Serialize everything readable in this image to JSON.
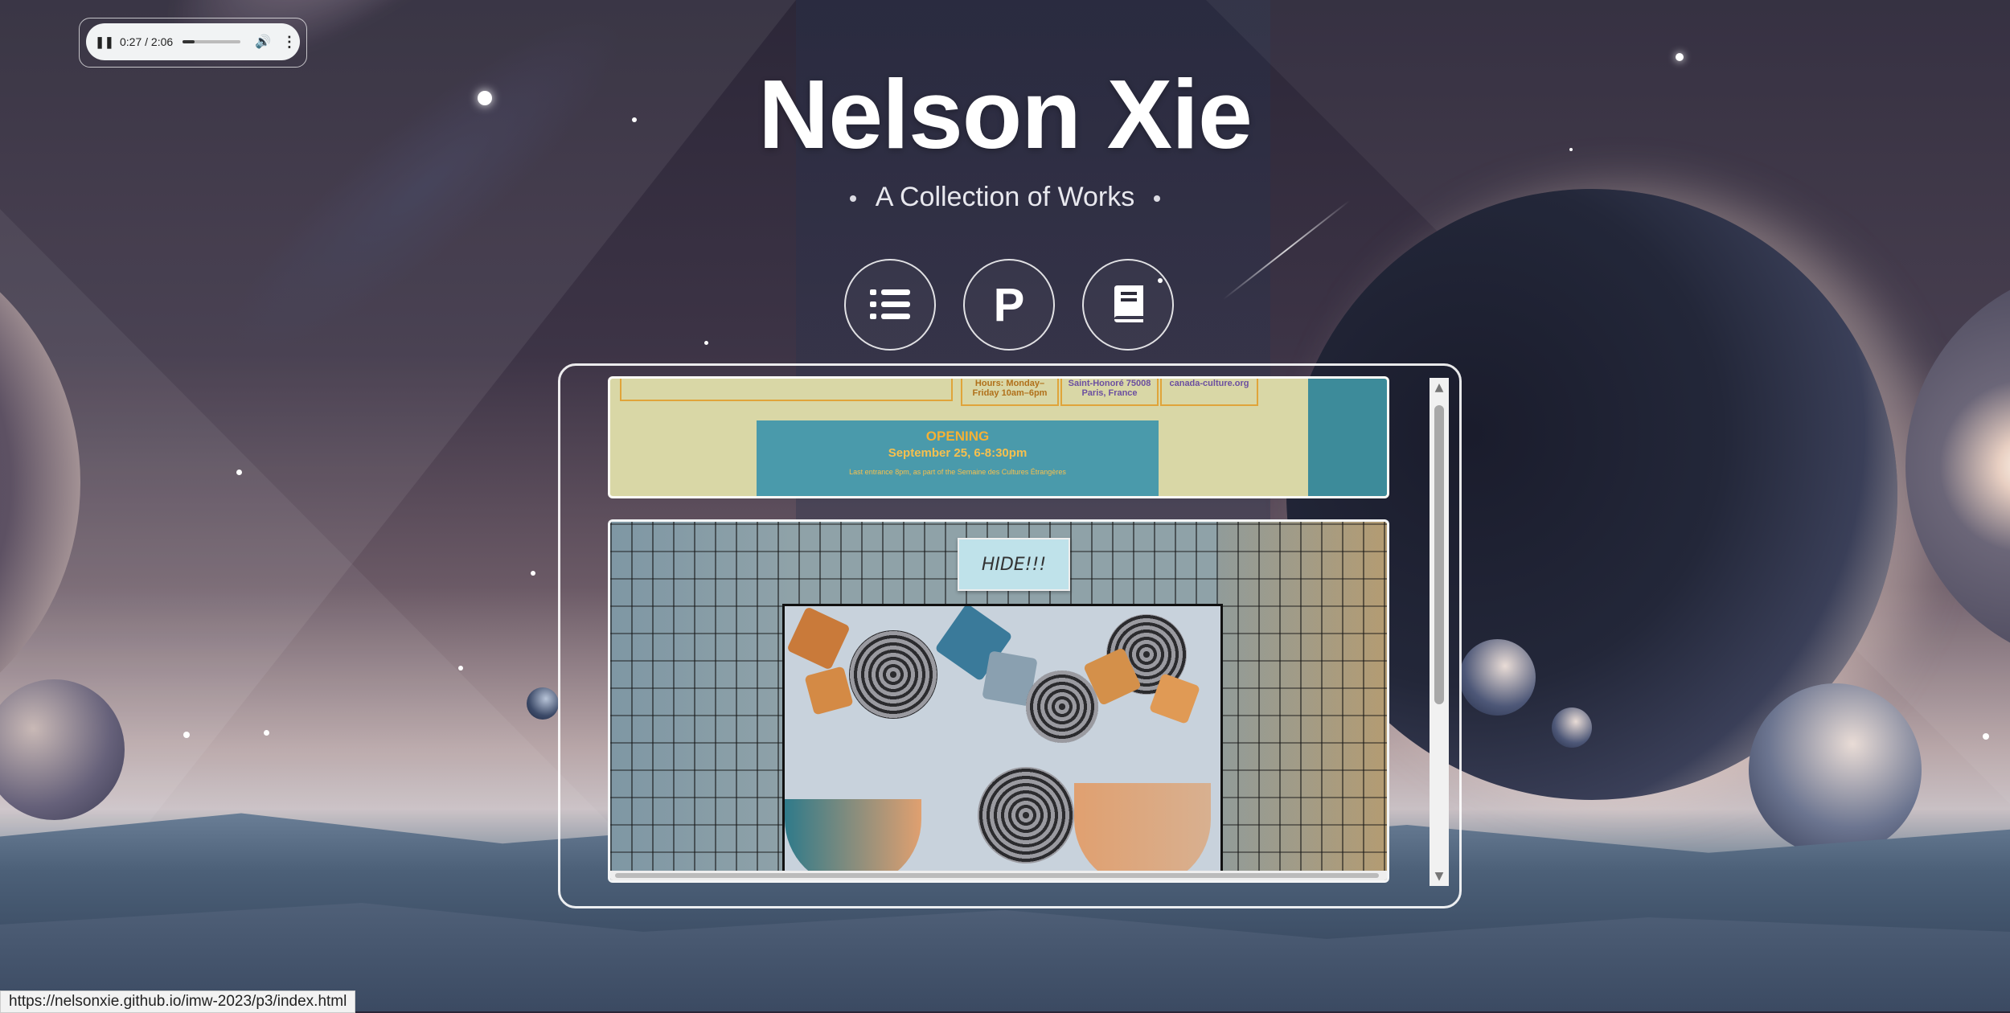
{
  "audio": {
    "time": "0:27 / 2:06",
    "progress": 0.214,
    "pause_icon": "pause-icon",
    "volume_icon": "volume-icon",
    "more_icon": "more-vert-icon"
  },
  "header": {
    "title": "Nelson Xie",
    "subtitle": "A Collection of Works"
  },
  "nav": {
    "buttons": [
      {
        "icon": "list-icon"
      },
      {
        "icon": "p-logo-icon",
        "glyph": "P"
      },
      {
        "icon": "book-icon"
      }
    ]
  },
  "preview1": {
    "box1": "Hours: Monday–\nFriday 10am–6pm",
    "box2": "Saint-Honoré 75008\nParis, France",
    "box3": "canada-culture.org",
    "opening": "OPENING",
    "date": "September 25, 6-8:30pm",
    "small": "Last entrance 8pm, as part of the Semaine des Cultures Étrangères"
  },
  "preview2": {
    "hide_button": "HIDE!!!"
  },
  "status_url": "https://nelsonxie.github.io/imw-2023/p3/index.html",
  "colors": {
    "accent_teal": "#4a9aab",
    "poster_yellow": "#d9d7a6",
    "opening_orange": "#f4b135",
    "hide_button_bg": "#bfe2ea"
  }
}
